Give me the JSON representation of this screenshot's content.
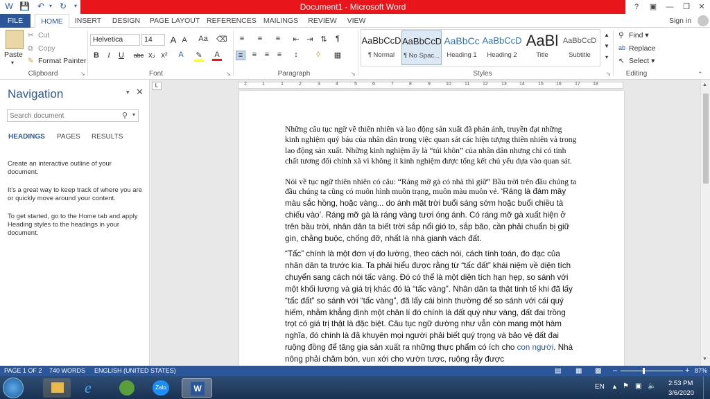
{
  "window": {
    "title": "Document1 - Microsoft Word",
    "help": "?",
    "sign_in": "Sign in"
  },
  "tabs": [
    "FILE",
    "HOME",
    "INSERT",
    "DESIGN",
    "PAGE LAYOUT",
    "REFERENCES",
    "MAILINGS",
    "REVIEW",
    "VIEW"
  ],
  "clipboard": {
    "paste": "Paste",
    "cut": "Cut",
    "copy": "Copy",
    "format_painter": "Format Painter",
    "label": "Clipboard"
  },
  "font": {
    "name": "Helvetica",
    "size": "14",
    "grow": "A",
    "shrink": "A",
    "case": "Aa",
    "bold": "B",
    "italic": "I",
    "underline": "U",
    "strike": "abc",
    "sub": "x₂",
    "sup": "x²",
    "label": "Font"
  },
  "paragraph": {
    "label": "Paragraph"
  },
  "styles": {
    "label": "Styles",
    "items": [
      {
        "preview": "AaBbCcD",
        "name": "¶ Normal"
      },
      {
        "preview": "AaBbCcD",
        "name": "¶ No Spac..."
      },
      {
        "preview": "AaBbCc",
        "name": "Heading 1"
      },
      {
        "preview": "AaBbCcD",
        "name": "Heading 2"
      },
      {
        "preview": "AaBl",
        "name": "Title"
      },
      {
        "preview": "AaBbCcD",
        "name": "Subtitle"
      }
    ]
  },
  "editing": {
    "find": "Find",
    "replace": "Replace",
    "select": "Select",
    "label": "Editing"
  },
  "nav": {
    "title": "Navigation",
    "search_placeholder": "Search document",
    "tabs": [
      "HEADINGS",
      "PAGES",
      "RESULTS"
    ],
    "p1": "Create an interactive outline of your document.",
    "p2": "It's a great way to keep track of where you are or quickly move around your content.",
    "p3": "To get started, go to the Home tab and apply Heading styles to the headings in your document."
  },
  "ruler": {
    "marks": [
      "2",
      "1",
      "1",
      "2",
      "3",
      "4",
      "5",
      "6",
      "7",
      "8",
      "9",
      "10",
      "11",
      "12",
      "13",
      "14",
      "15",
      "16",
      "17",
      "18"
    ]
  },
  "document": {
    "para1": "Những câu tục ngữ về thiên nhiên và lao động sản xuất đã phản ánh, truyền đạt những kinh nghiệm quý báu của nhân dân trong việc quan sát các hiện tượng thiên nhiên và trong lao động sản xuất. Những kinh nghiệm ấy là “túi khôn” của nhân dân nhưng chỉ có tính chất tương đối chính xã vì không ít kinh nghiệm được tổng kết chủ yếu dựa vào quan sát.",
    "para2a": "Nói về tục ngữ thiên nhiên có câu: “Ráng mỡ gà có nhà thì giữ” Bầu trời trên đầu chúng ta cũng có muôn hình muôn trạng, muôn màu muôn vẻ.",
    "para2b": " ‘Ráng là đám mây màu sắc hồng, hoặc vàng... do ánh mặt trời buổi sáng sớm hoặc buổi chiều tà chiếu vào’. Ráng mỡ gà là ráng vàng tươi óng ánh. Có ráng mỡ gà xuất hiện ở trên bầu trời, nhân dân ta biết trời sắp nổi gió to, sắp bão, cần phải chuẩn bị giữ gìn, chằng buộc, chống đỡ, nhất là nhà gianh vách đất.",
    "para3": "“Tấc” chính là một đơn vị đo lường, theo cách nói, cách tính toán, đo đạc của nhân dân ta trước kia. Ta phải hiểu được rằng từ “tấc đất” khái niệm về diện tích chuyển sang cách nói tấc vàng. Đó có thể là một diện tích hạn hẹp, so sánh với một khối lượng và giá trị khác đó là “tấc vàng”. Nhân dân ta thật tinh tế khi đã lấy “tấc đất” so sánh với “tấc vàng”, đã lấy cái bình thường để so sánh với cái quý hiếm, nhằm khẳng định một chân lí đó chính là đất quý như vàng, đất đai trồng trọt có giá trị thật là đặc biệt. Câu tục ngữ dường như vẫn còn mang một hàm nghĩa, đó chính là đã khuyên mọi người phải biết quý trọng và bảo vệ đất đai ruộng đồng để tăng gia sản xuất ra những thực phẩm có ích cho",
    "para3_link": "con người",
    "para3_end": ". Nhà nông phải chăm bón, vun xới cho vườn tược, ruộng rẫy được"
  },
  "status": {
    "page": "PAGE 1 OF 2",
    "words": "740 WORDS",
    "language": "ENGLISH (UNITED STATES)",
    "zoom": "87%"
  },
  "taskbar": {
    "lang": "EN",
    "time": "2:53 PM",
    "date": "3/6/2020",
    "zalo": "Zalo"
  },
  "colors": {
    "accent": "#2b579a",
    "title_red": "#e8151b"
  }
}
